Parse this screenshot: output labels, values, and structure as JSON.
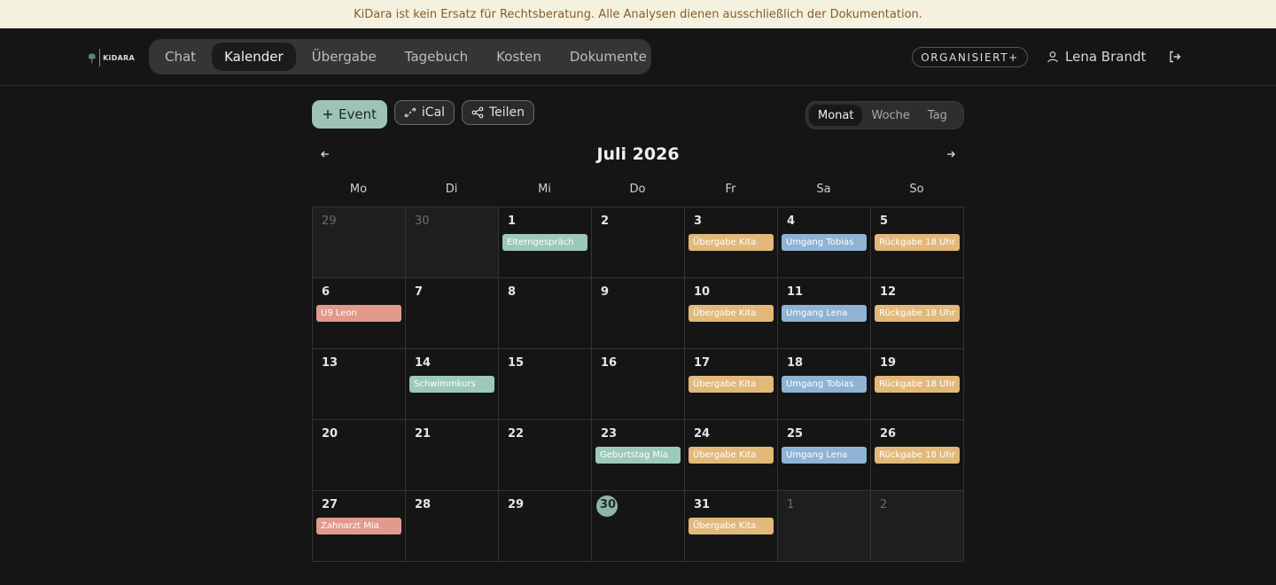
{
  "banner": "KiDara ist kein Ersatz für Rechtsberatung. Alle Analysen dienen ausschließlich der Dokumentation.",
  "logo_text": "KiDARA",
  "nav": [
    {
      "label": "Chat",
      "active": false
    },
    {
      "label": "Kalender",
      "active": true
    },
    {
      "label": "Übergabe",
      "active": false
    },
    {
      "label": "Tagebuch",
      "active": false
    },
    {
      "label": "Kosten",
      "active": false
    },
    {
      "label": "Dokumente",
      "active": false
    }
  ],
  "plan_badge": "ORGANISIERT+",
  "user_name": "Lena Brandt",
  "toolbar": {
    "event_label": "Event",
    "ical_label": "iCal",
    "share_label": "Teilen",
    "views": [
      {
        "label": "Monat",
        "active": true
      },
      {
        "label": "Woche",
        "active": false
      },
      {
        "label": "Tag",
        "active": false
      }
    ]
  },
  "month_title": "Juli 2026",
  "weekdays": [
    "Mo",
    "Di",
    "Mi",
    "Do",
    "Fr",
    "Sa",
    "So"
  ],
  "colors": {
    "green": "#9cc9b8",
    "yellow": "#e2b97a",
    "blue": "#8fb3d4",
    "red": "#e29a8c"
  },
  "days": [
    {
      "day": "29",
      "outside": true
    },
    {
      "day": "30",
      "outside": true
    },
    {
      "day": "1",
      "event": "Elterngespräch",
      "color": "green"
    },
    {
      "day": "2"
    },
    {
      "day": "3",
      "event": "Übergabe Kita",
      "color": "yellow"
    },
    {
      "day": "4",
      "event": "Umgang Tobias",
      "color": "blue"
    },
    {
      "day": "5",
      "event": "Rückgabe 18 Uhr",
      "color": "yellow"
    },
    {
      "day": "6",
      "event": "U9 Leon",
      "color": "red"
    },
    {
      "day": "7"
    },
    {
      "day": "8"
    },
    {
      "day": "9"
    },
    {
      "day": "10",
      "event": "Übergabe Kita",
      "color": "yellow"
    },
    {
      "day": "11",
      "event": "Umgang Lena",
      "color": "blue"
    },
    {
      "day": "12",
      "event": "Rückgabe 18 Uhr",
      "color": "yellow"
    },
    {
      "day": "13"
    },
    {
      "day": "14",
      "event": "Schwimmkurs",
      "color": "green"
    },
    {
      "day": "15"
    },
    {
      "day": "16"
    },
    {
      "day": "17",
      "event": "Übergabe Kita",
      "color": "yellow"
    },
    {
      "day": "18",
      "event": "Umgang Tobias",
      "color": "blue"
    },
    {
      "day": "19",
      "event": "Rückgabe 18 Uhr",
      "color": "yellow"
    },
    {
      "day": "20"
    },
    {
      "day": "21"
    },
    {
      "day": "22"
    },
    {
      "day": "23",
      "event": "Geburtstag Mia",
      "color": "green"
    },
    {
      "day": "24",
      "event": "Übergabe Kita",
      "color": "yellow"
    },
    {
      "day": "25",
      "event": "Umgang Lena",
      "color": "blue"
    },
    {
      "day": "26",
      "event": "Rückgabe 18 Uhr",
      "color": "yellow"
    },
    {
      "day": "27",
      "event": "Zahnarzt Mia",
      "color": "red"
    },
    {
      "day": "28"
    },
    {
      "day": "29"
    },
    {
      "day": "30",
      "today": true
    },
    {
      "day": "31",
      "event": "Übergabe Kita",
      "color": "yellow"
    },
    {
      "day": "1",
      "outside": true
    },
    {
      "day": "2",
      "outside": true
    }
  ]
}
